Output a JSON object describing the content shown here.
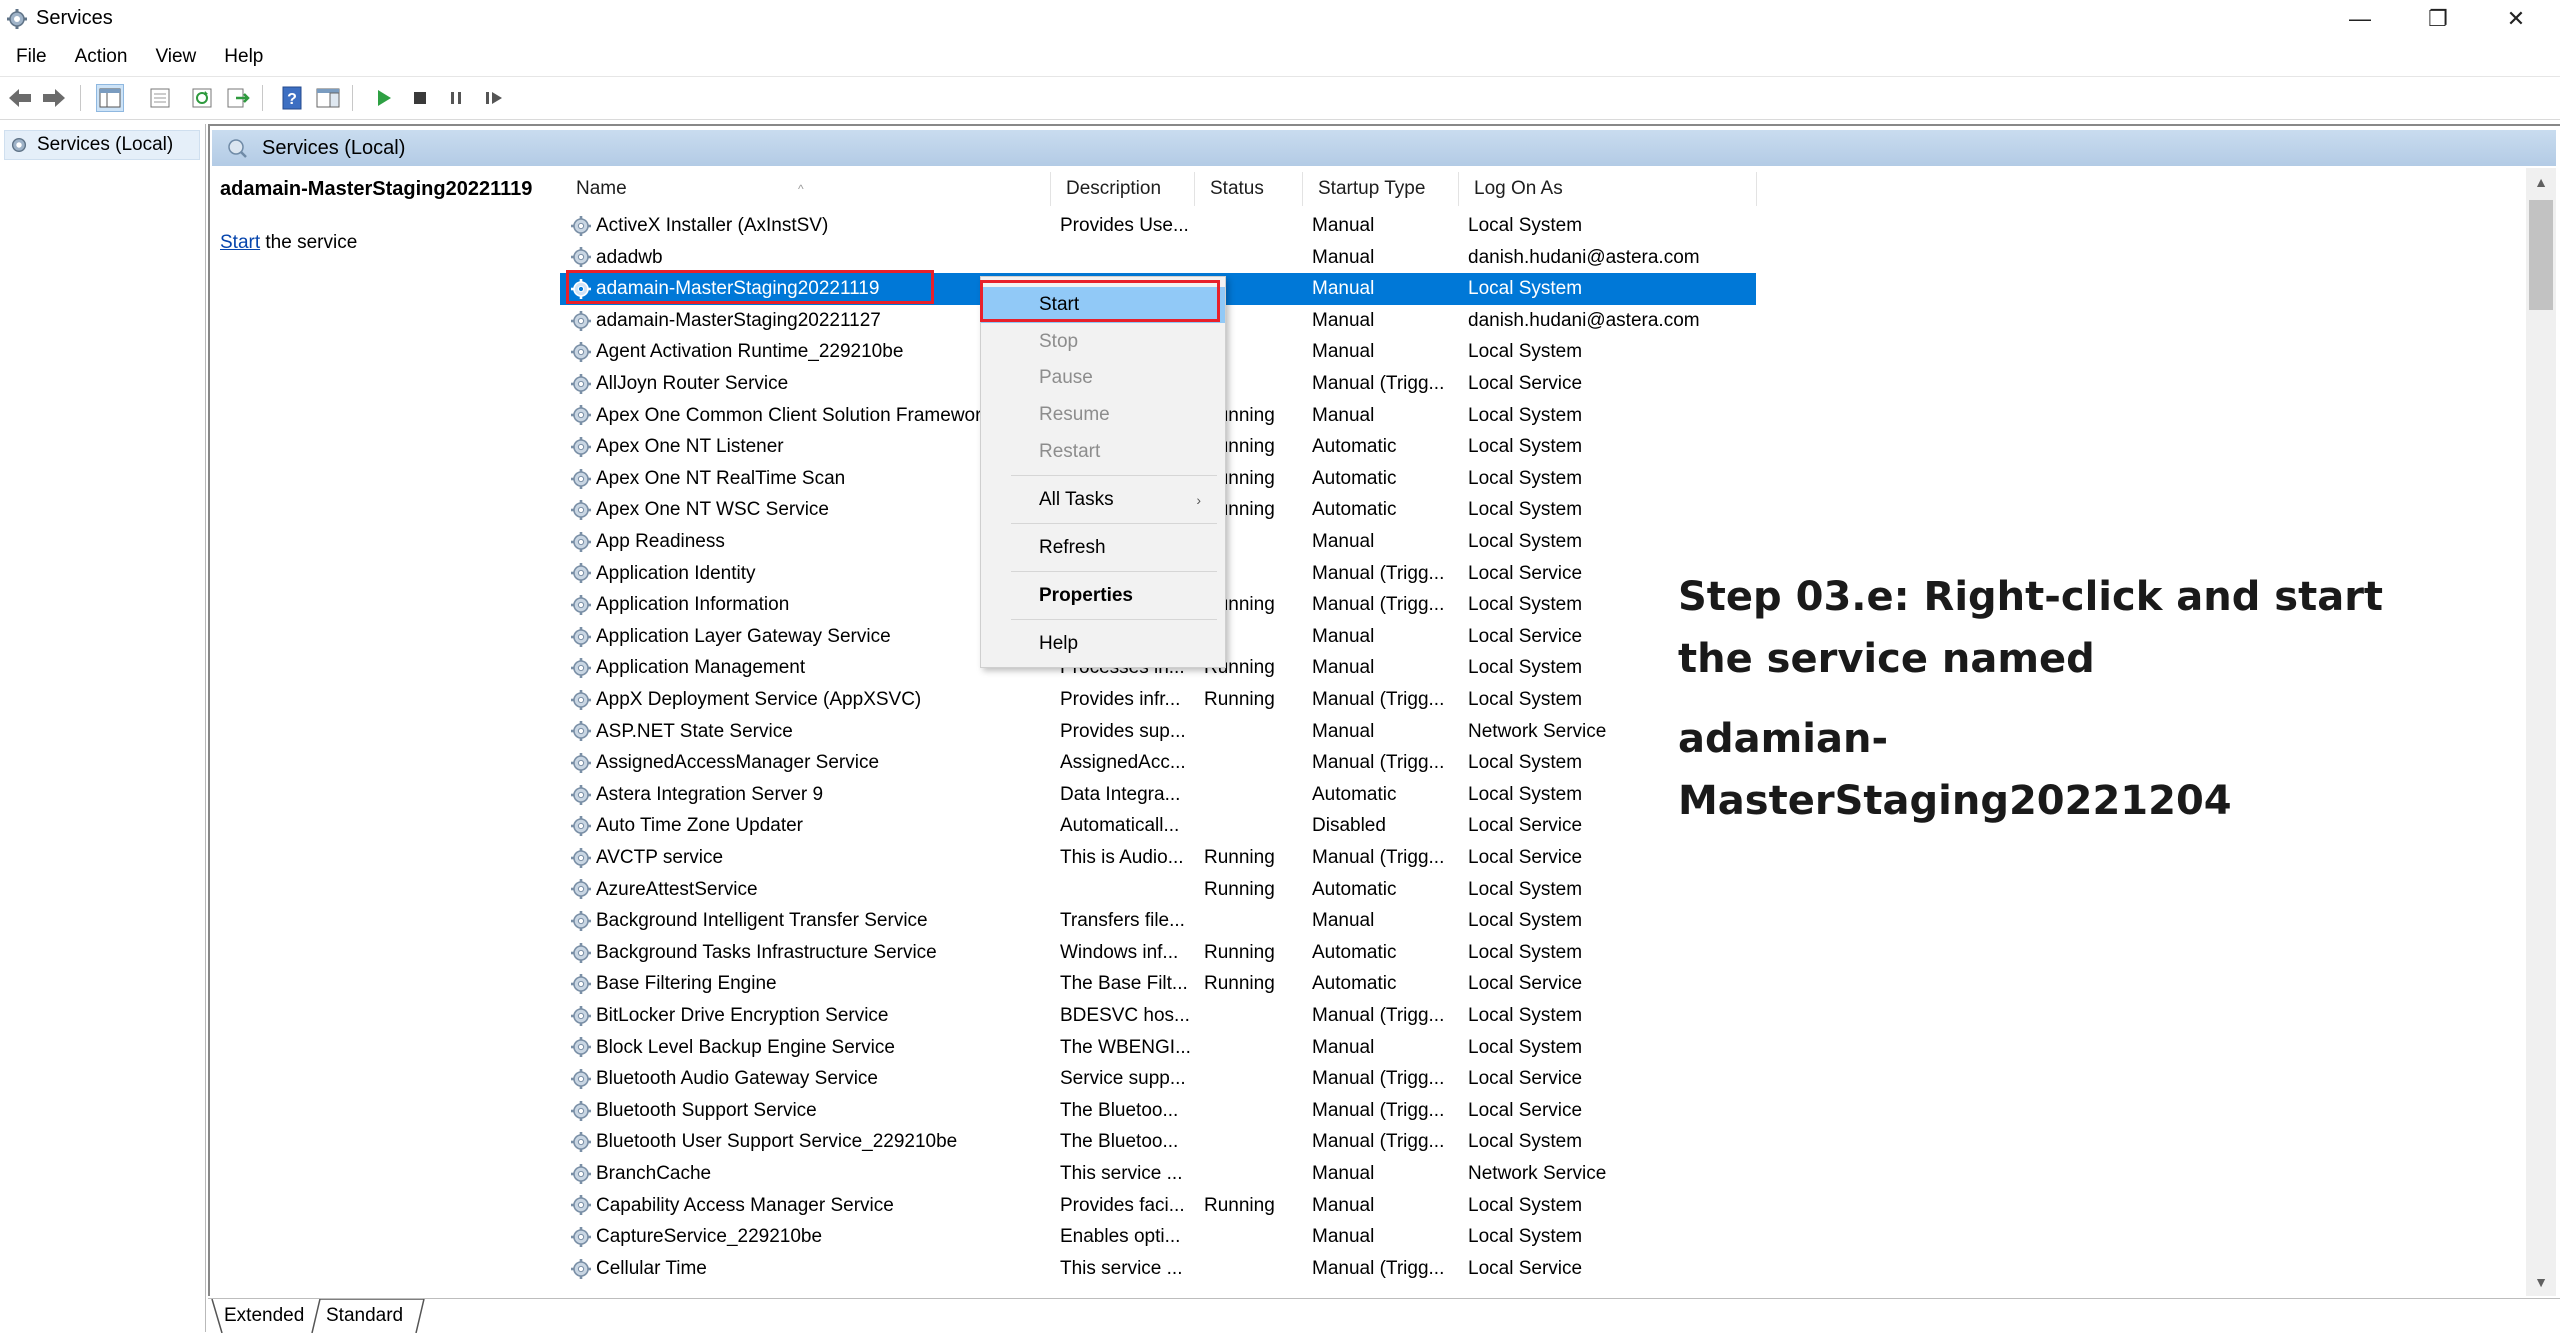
{
  "window": {
    "title": "Services",
    "minimize": "—",
    "restore": "❐",
    "close": "✕"
  },
  "menu": [
    "File",
    "Action",
    "View",
    "Help"
  ],
  "tree": {
    "node": "Services (Local)"
  },
  "content_header": "Services (Local)",
  "description_panel": {
    "service_title": "adamain-MasterStaging20221119",
    "link": "Start",
    "link_suffix": " the service"
  },
  "columns": [
    "Name",
    "Description",
    "Status",
    "Startup Type",
    "Log On As"
  ],
  "rows": [
    {
      "name": "ActiveX Installer (AxInstSV)",
      "desc": "Provides Use...",
      "status": "",
      "startup": "Manual",
      "logon": "Local System"
    },
    {
      "name": "adadwb",
      "desc": "",
      "status": "",
      "startup": "Manual",
      "logon": "danish.hudani@astera.com"
    },
    {
      "name": "adamain-MasterStaging20221119",
      "desc": "",
      "status": "",
      "startup": "Manual",
      "logon": "Local System"
    },
    {
      "name": "adamain-MasterStaging20221127",
      "desc": "",
      "status": "",
      "startup": "Manual",
      "logon": "danish.hudani@astera.com"
    },
    {
      "name": "Agent Activation Runtime_229210be",
      "desc": "",
      "status": "",
      "startup": "Manual",
      "logon": "Local System"
    },
    {
      "name": "AllJoyn Router Service",
      "desc": "",
      "status": "",
      "startup": "Manual (Trigg...",
      "logon": "Local Service"
    },
    {
      "name": "Apex One Common Client Solution Framework",
      "desc": "",
      "status": "Running",
      "startup": "Manual",
      "logon": "Local System"
    },
    {
      "name": "Apex One NT Listener",
      "desc": "",
      "status": "Running",
      "startup": "Automatic",
      "logon": "Local System"
    },
    {
      "name": "Apex One NT RealTime Scan",
      "desc": "",
      "status": "Running",
      "startup": "Automatic",
      "logon": "Local System"
    },
    {
      "name": "Apex One NT WSC Service",
      "desc": "",
      "status": "Running",
      "startup": "Automatic",
      "logon": "Local System"
    },
    {
      "name": "App Readiness",
      "desc": "",
      "status": "",
      "startup": "Manual",
      "logon": "Local System"
    },
    {
      "name": "Application Identity",
      "desc": "",
      "status": "",
      "startup": "Manual (Trigg...",
      "logon": "Local Service"
    },
    {
      "name": "Application Information",
      "desc": "",
      "status": "Running",
      "startup": "Manual (Trigg...",
      "logon": "Local System"
    },
    {
      "name": "Application Layer Gateway Service",
      "desc": "",
      "status": "",
      "startup": "Manual",
      "logon": "Local Service"
    },
    {
      "name": "Application Management",
      "desc": "Processes in...",
      "status": "Running",
      "startup": "Manual",
      "logon": "Local System"
    },
    {
      "name": "AppX Deployment Service (AppXSVC)",
      "desc": "Provides infr...",
      "status": "Running",
      "startup": "Manual (Trigg...",
      "logon": "Local System"
    },
    {
      "name": "ASP.NET State Service",
      "desc": "Provides sup...",
      "status": "",
      "startup": "Manual",
      "logon": "Network Service"
    },
    {
      "name": "AssignedAccessManager Service",
      "desc": "AssignedAcc...",
      "status": "",
      "startup": "Manual (Trigg...",
      "logon": "Local System"
    },
    {
      "name": "Astera Integration Server 9",
      "desc": "Data Integra...",
      "status": "",
      "startup": "Automatic",
      "logon": "Local System"
    },
    {
      "name": "Auto Time Zone Updater",
      "desc": "Automaticall...",
      "status": "",
      "startup": "Disabled",
      "logon": "Local Service"
    },
    {
      "name": "AVCTP service",
      "desc": "This is Audio...",
      "status": "Running",
      "startup": "Manual (Trigg...",
      "logon": "Local Service"
    },
    {
      "name": "AzureAttestService",
      "desc": "",
      "status": "Running",
      "startup": "Automatic",
      "logon": "Local System"
    },
    {
      "name": "Background Intelligent Transfer Service",
      "desc": "Transfers file...",
      "status": "",
      "startup": "Manual",
      "logon": "Local System"
    },
    {
      "name": "Background Tasks Infrastructure Service",
      "desc": "Windows inf...",
      "status": "Running",
      "startup": "Automatic",
      "logon": "Local System"
    },
    {
      "name": "Base Filtering Engine",
      "desc": "The Base Filt...",
      "status": "Running",
      "startup": "Automatic",
      "logon": "Local Service"
    },
    {
      "name": "BitLocker Drive Encryption Service",
      "desc": "BDESVC hos...",
      "status": "",
      "startup": "Manual (Trigg...",
      "logon": "Local System"
    },
    {
      "name": "Block Level Backup Engine Service",
      "desc": "The WBENGI...",
      "status": "",
      "startup": "Manual",
      "logon": "Local System"
    },
    {
      "name": "Bluetooth Audio Gateway Service",
      "desc": "Service supp...",
      "status": "",
      "startup": "Manual (Trigg...",
      "logon": "Local Service"
    },
    {
      "name": "Bluetooth Support Service",
      "desc": "The Bluetoo...",
      "status": "",
      "startup": "Manual (Trigg...",
      "logon": "Local Service"
    },
    {
      "name": "Bluetooth User Support Service_229210be",
      "desc": "The Bluetoo...",
      "status": "",
      "startup": "Manual (Trigg...",
      "logon": "Local System"
    },
    {
      "name": "BranchCache",
      "desc": "This service ...",
      "status": "",
      "startup": "Manual",
      "logon": "Network Service"
    },
    {
      "name": "Capability Access Manager Service",
      "desc": "Provides faci...",
      "status": "Running",
      "startup": "Manual",
      "logon": "Local System"
    },
    {
      "name": "CaptureService_229210be",
      "desc": "Enables opti...",
      "status": "",
      "startup": "Manual",
      "logon": "Local System"
    },
    {
      "name": "Cellular Time",
      "desc": "This service ...",
      "status": "",
      "startup": "Manual (Trigg...",
      "logon": "Local Service"
    }
  ],
  "context_menu": {
    "start": "Start",
    "stop": "Stop",
    "pause": "Pause",
    "resume": "Resume",
    "restart": "Restart",
    "all_tasks": "All Tasks",
    "all_tasks_arrow": "›",
    "refresh": "Refresh",
    "properties": "Properties",
    "help": "Help"
  },
  "annotation": {
    "line1": "Step 03.e: Right-click and start the service named",
    "line2": "adamian-MasterStaging20221204"
  },
  "tabs": {
    "extended": "Extended",
    "standard": "Standard"
  },
  "colors": {
    "selection": "#0078d7",
    "highlight_box": "#e8202a",
    "menu_hover": "#91c9f7",
    "header_band": "#b9cfe7"
  }
}
